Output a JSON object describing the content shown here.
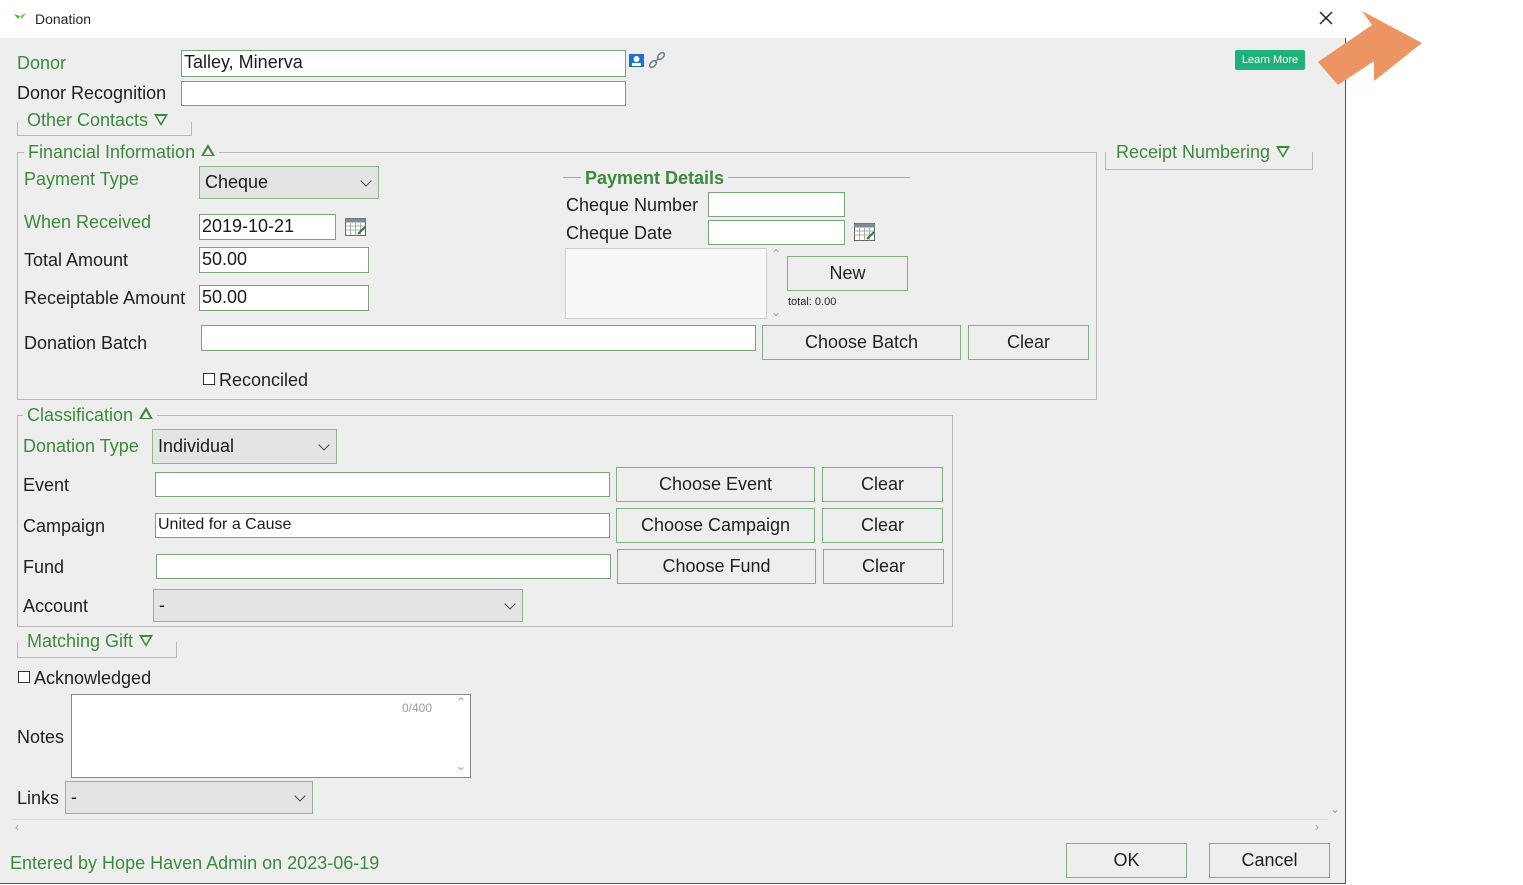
{
  "window": {
    "title": "Donation",
    "learn_more": "Learn More"
  },
  "donor": {
    "label": "Donor",
    "value": "Talley, Minerva",
    "recognition_label": "Donor Recognition",
    "recognition_value": ""
  },
  "sections": {
    "other_contacts": "Other Contacts",
    "financial_information": "Financial Information",
    "receipt_numbering": "Receipt Numbering",
    "classification": "Classification",
    "matching_gift": "Matching Gift"
  },
  "financial": {
    "payment_type_label": "Payment Type",
    "payment_type_value": "Cheque",
    "when_received_label": "When Received",
    "when_received_value": "2019-10-21",
    "total_amount_label": "Total Amount",
    "total_amount_value": "50.00",
    "receiptable_amount_label": "Receiptable Amount",
    "receiptable_amount_value": "50.00",
    "donation_batch_label": "Donation Batch",
    "donation_batch_value": "",
    "choose_batch_button": "Choose Batch",
    "clear_button": "Clear",
    "reconciled_label": "Reconciled",
    "reconciled_checked": false
  },
  "payment_details": {
    "heading": "Payment Details",
    "cheque_number_label": "Cheque Number",
    "cheque_number_value": "",
    "cheque_date_label": "Cheque Date",
    "cheque_date_value": "",
    "new_button": "New",
    "total_text": "total: 0.00"
  },
  "classification": {
    "donation_type_label": "Donation Type",
    "donation_type_value": "Individual",
    "event_label": "Event",
    "event_value": "",
    "choose_event_button": "Choose Event",
    "campaign_label": "Campaign",
    "campaign_value": "United for a Cause",
    "choose_campaign_button": "Choose Campaign",
    "fund_label": "Fund",
    "fund_value": "",
    "choose_fund_button": "Choose Fund",
    "clear_button": "Clear",
    "account_label": "Account",
    "account_value": "-"
  },
  "bottom": {
    "acknowledged_label": "Acknowledged",
    "acknowledged_checked": false,
    "notes_label": "Notes",
    "notes_value": "",
    "notes_counter": "0/400",
    "links_label": "Links",
    "links_value": "-",
    "entered_by": "Entered by Hope Haven Admin on 2023-06-19",
    "ok_button": "OK",
    "cancel_button": "Cancel"
  },
  "colors": {
    "label_green": "#3c8a3c",
    "learn_more_bg": "#20b07a",
    "arrow": "#ec9562"
  }
}
